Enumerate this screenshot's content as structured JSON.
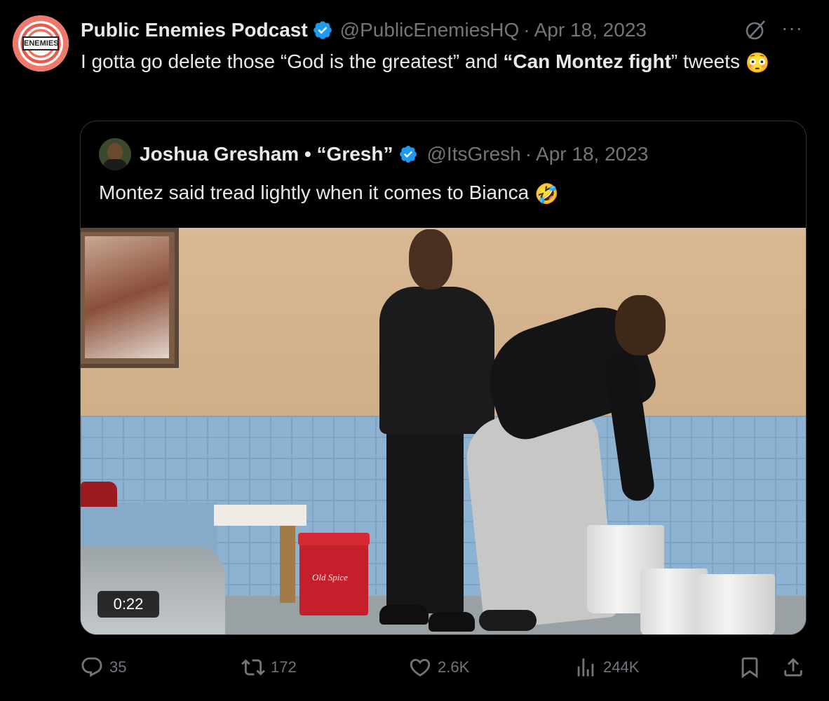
{
  "tweet": {
    "author_name": "Public Enemies Podcast",
    "author_handle": "@PublicEnemiesHQ",
    "separator": "·",
    "date": "Apr 18, 2023",
    "avatar_text": "ENEMIES",
    "text_part1": "I gotta go delete those “God is the greatest” and ",
    "text_bold": "“Can Montez fight",
    "text_part2": "” tweets ",
    "text_emoji": "😳"
  },
  "quote": {
    "author_name": "Joshua Gresham • “Gresh”",
    "author_handle": "@ItsGresh",
    "separator": "·",
    "date": "Apr 18, 2023",
    "text": "Montez said tread lightly when it comes to Bianca ",
    "text_emoji": "🤣",
    "media": {
      "duration": "0:22",
      "cooler_logo": "Old Spice"
    }
  },
  "actions": {
    "replies": "35",
    "retweets": "172",
    "likes": "2.6K",
    "views": "244K"
  },
  "colors": {
    "background": "#000000",
    "text": "#e7e9ea",
    "muted": "#71767b",
    "verified": "#1d9bf0",
    "border": "#2f3336"
  }
}
